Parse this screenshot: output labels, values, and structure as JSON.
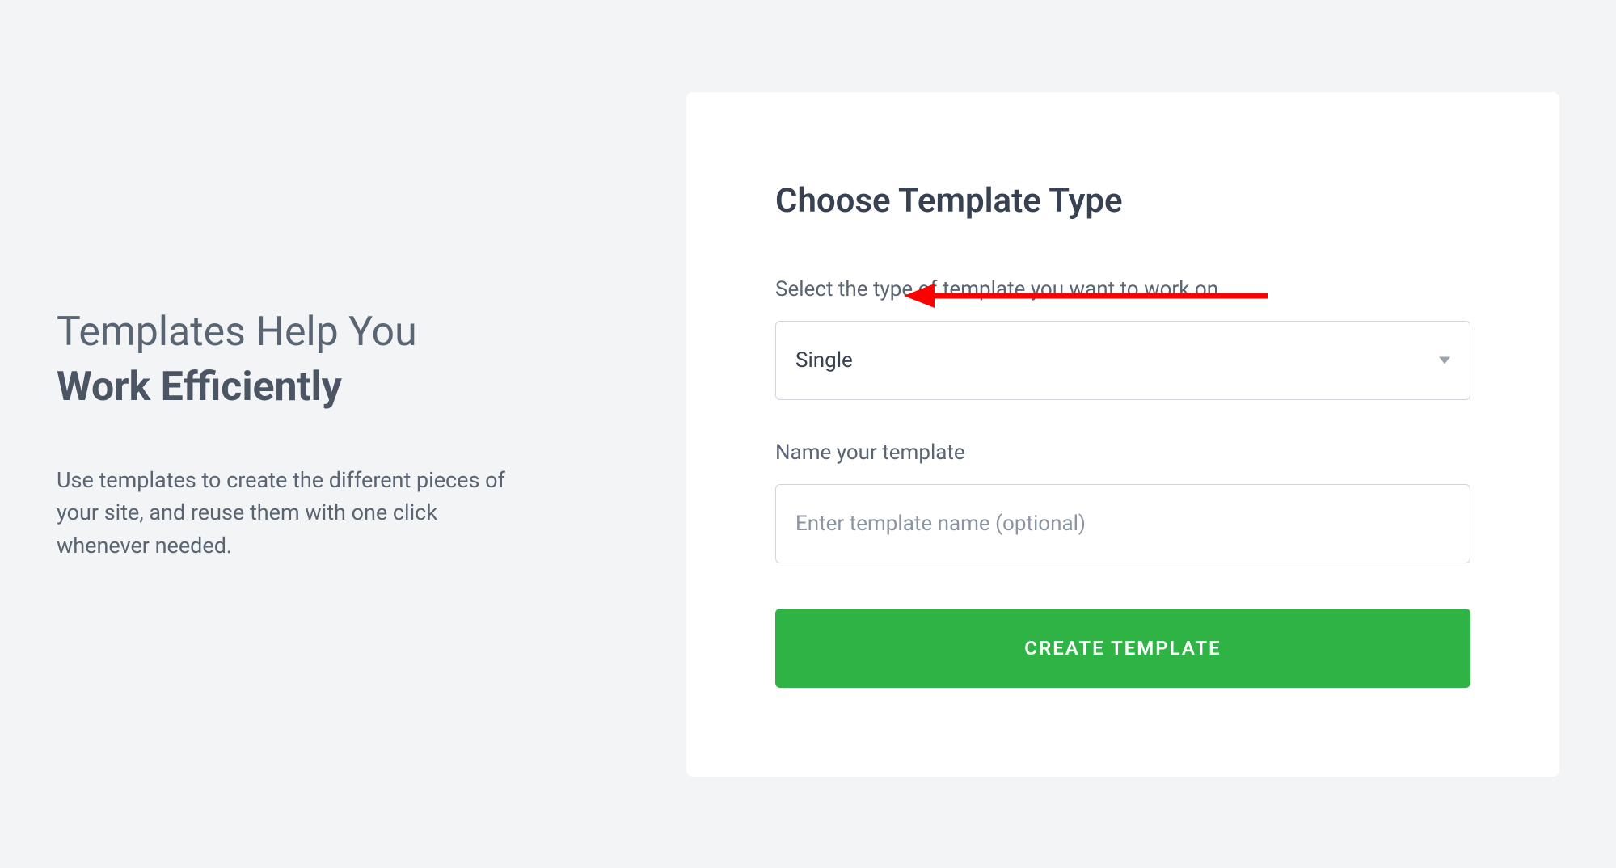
{
  "left": {
    "heading_light": "Templates Help You",
    "heading_bold": "Work Efficiently",
    "description": "Use templates to create the different pieces of your site, and reuse them with one click whenever needed."
  },
  "card": {
    "title": "Choose Template Type",
    "select_label": "Select the type of template you want to work on",
    "select_value": "Single",
    "name_label": "Name your template",
    "name_placeholder": "Enter template name (optional)",
    "name_value": "",
    "button_label": "CREATE TEMPLATE"
  },
  "colors": {
    "accent": "#2fb344",
    "annotation": "#ff0000"
  }
}
